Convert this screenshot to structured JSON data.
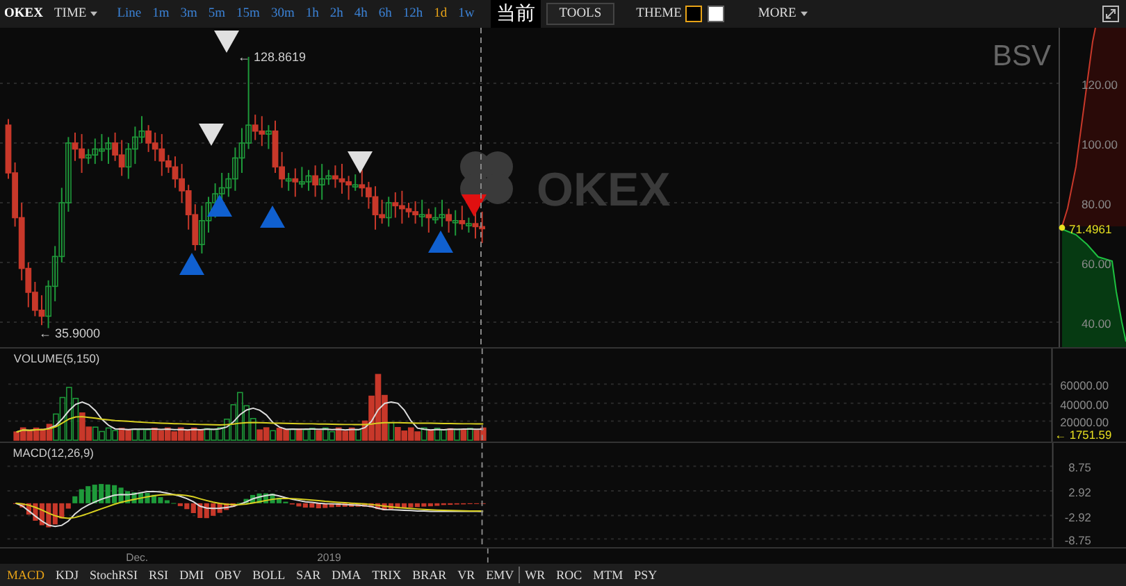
{
  "toolbar": {
    "brand": "OKEX",
    "time_menu": "TIME",
    "intervals": [
      {
        "label": "Line",
        "selected": false
      },
      {
        "label": "1m",
        "selected": false
      },
      {
        "label": "3m",
        "selected": false
      },
      {
        "label": "5m",
        "selected": false
      },
      {
        "label": "15m",
        "selected": false
      },
      {
        "label": "30m",
        "selected": false
      },
      {
        "label": "1h",
        "selected": false
      },
      {
        "label": "2h",
        "selected": false
      },
      {
        "label": "4h",
        "selected": false
      },
      {
        "label": "6h",
        "selected": false
      },
      {
        "label": "12h",
        "selected": false
      },
      {
        "label": "1d",
        "selected": true
      },
      {
        "label": "1w",
        "selected": false
      }
    ],
    "overlay_label": "当前",
    "tools": "TOOLS",
    "theme": "THEME",
    "theme_swatches": [
      {
        "color": "#000000",
        "selected": true
      },
      {
        "color": "#ffffff",
        "selected": false
      }
    ],
    "more": "MORE"
  },
  "chart": {
    "logo": "OKEX",
    "symbol": "BSV",
    "high_label": "← 128.8619",
    "low_label": "← 35.9000",
    "price_axis": [
      "120.00",
      "100.00",
      "80.00",
      "60.00",
      "40.00"
    ],
    "last_price": "71.4961"
  },
  "volume": {
    "title": "VOLUME(5,150)",
    "axis": [
      "60000.00",
      "40000.00",
      "20000.00"
    ],
    "last": "← 1751.59"
  },
  "macd": {
    "title": "MACD(12,26,9)",
    "axis": [
      "8.75",
      "2.92",
      "-2.92",
      "-8.75"
    ]
  },
  "date_axis": [
    "Dec.",
    "2019"
  ],
  "main_indicators": [
    {
      "label": "MACD",
      "selected": true
    },
    {
      "label": "KDJ",
      "selected": false
    },
    {
      "label": "StochRSI",
      "selected": false
    },
    {
      "label": "RSI",
      "selected": false
    },
    {
      "label": "DMI",
      "selected": false
    },
    {
      "label": "OBV",
      "selected": false
    },
    {
      "label": "BOLL",
      "selected": false
    },
    {
      "label": "SAR",
      "selected": false
    },
    {
      "label": "DMA",
      "selected": false
    },
    {
      "label": "TRIX",
      "selected": false
    },
    {
      "label": "BRAR",
      "selected": false
    },
    {
      "label": "VR",
      "selected": false
    },
    {
      "label": "EMV",
      "selected": false
    }
  ],
  "other_indicators": [
    {
      "label": "WR",
      "selected": false
    },
    {
      "label": "ROC",
      "selected": false
    },
    {
      "label": "MTM",
      "selected": false
    },
    {
      "label": "PSY",
      "selected": false
    }
  ]
}
